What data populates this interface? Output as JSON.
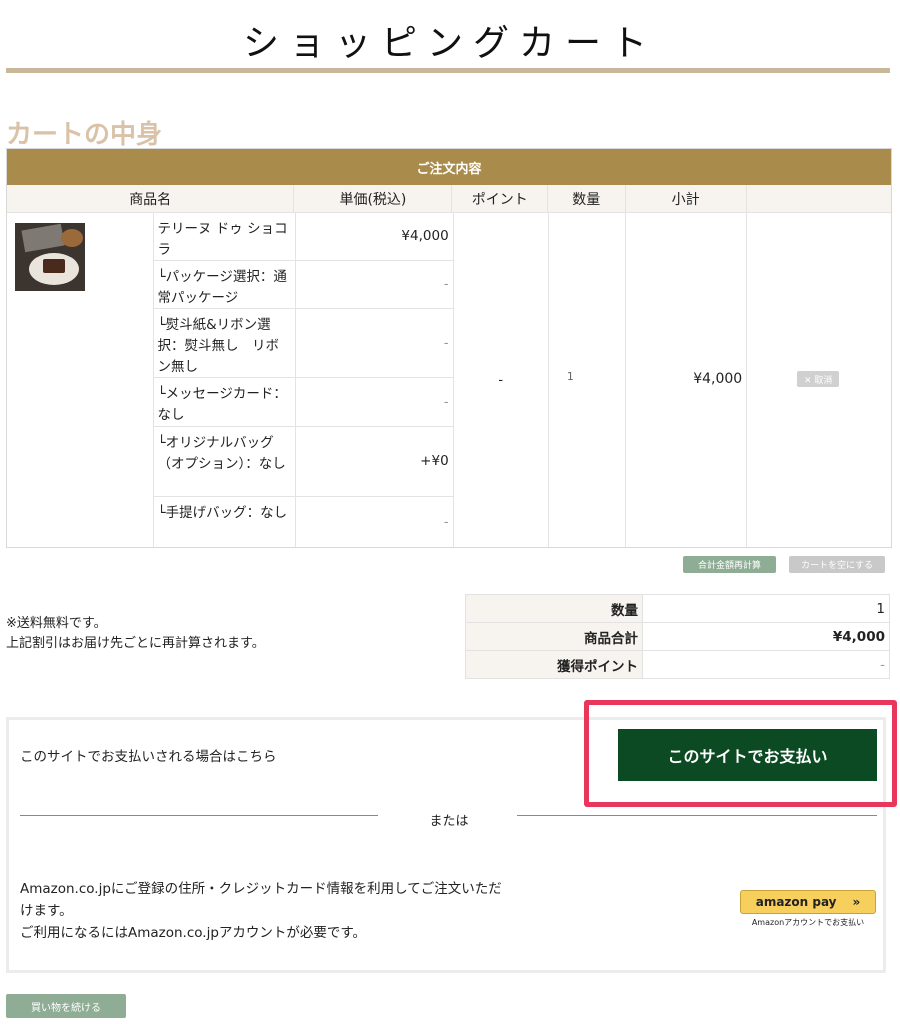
{
  "page": {
    "title": "ショッピングカート",
    "section_heading": "カートの中身"
  },
  "cart": {
    "header": "ご注文内容",
    "columns": [
      "商品名",
      "単価(税込)",
      "ポイント",
      "数量",
      "小計"
    ],
    "product": {
      "name": "テリーヌ ドゥ ショコラ",
      "price": "¥4,000",
      "options": [
        {
          "label": "└パッケージ選択：通常パッケージ",
          "price": "-"
        },
        {
          "label": "└熨斗紙&リボン選択：熨斗無し　リボン無し",
          "price": "-"
        },
        {
          "label": "└メッセージカード：なし",
          "price": "-"
        },
        {
          "label": "└オリジナルバッグ（オプション）：なし",
          "price": "+¥0"
        },
        {
          "label": "└手提げバッグ：なし",
          "price": "-"
        }
      ],
      "points": "-",
      "quantity": "1",
      "subtotal": "¥4,000",
      "delete_label": "✕ 取消"
    },
    "recalc_label": "合計金額再計算",
    "empty_label": "カートを空にする"
  },
  "notes": {
    "free_shipping": "※送料無料です。",
    "discount": "上記割引はお届け先ごとに再計算されます。"
  },
  "summary": {
    "rows": [
      {
        "label": "数量",
        "value": "1"
      },
      {
        "label": "商品合計",
        "value": "¥4,000"
      },
      {
        "label": "獲得ポイント",
        "value": "-"
      }
    ]
  },
  "payment": {
    "site_text": "このサイトでお支払いされる場合はこちら",
    "site_button": "このサイトでお支払い",
    "or": "または",
    "amazon_text_1": "Amazon.co.jpにご登録の住所・クレジットカード情報を利用してご注文いただ",
    "amazon_text_2": "けます。",
    "amazon_text_3": "ご利用になるにはAmazon.co.jpアカウントが必要です。",
    "amazon_button": "amazon pay",
    "amazon_caption": "Amazonアカウントでお支払い",
    "highlight_color": "#e8375a"
  },
  "continue_label": "買い物を続ける"
}
